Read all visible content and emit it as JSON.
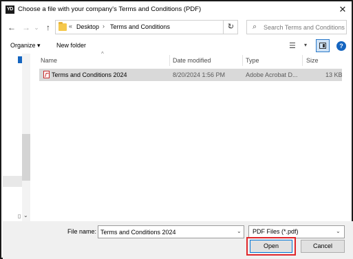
{
  "window": {
    "app_icon_text": "YD",
    "title": "Choose a file with your company's Terms and Conditions (PDF)",
    "close_glyph": "✕"
  },
  "nav": {
    "back_glyph": "←",
    "forward_glyph": "→",
    "recent_glyph": "⌄",
    "up_glyph": "↑",
    "breadcrumb_overflow": "«",
    "breadcrumbs": [
      {
        "label": "Desktop"
      },
      {
        "label": "Terms and Conditions"
      }
    ],
    "breadcrumb_sep": "›",
    "dropdown_glyph": "⌄",
    "refresh_glyph": "↻",
    "search_icon": "search-icon",
    "search_placeholder": "Search Terms and Conditions"
  },
  "toolbar": {
    "organize_label": "Organize ▾",
    "new_folder_label": "New folder",
    "view_glyph": "☰",
    "view_drop_glyph": "▾",
    "help_glyph": "?"
  },
  "filelist": {
    "columns": [
      "Name",
      "Date modified",
      "Type",
      "Size"
    ],
    "sort_glyph": "^",
    "rows": [
      {
        "name": "Terms and Conditions 2024",
        "date_modified": "8/20/2024 1:56 PM",
        "type": "Adobe Acrobat D...",
        "size": "13 KB",
        "selected": true
      }
    ]
  },
  "navpane": {
    "down_glyph": "⌄",
    "doc_glyph": "▯"
  },
  "footer": {
    "filename_label": "File name:",
    "filename_value": "Terms and Conditions 2024",
    "filename_drop_glyph": "⌄",
    "filetype_value": "PDF Files (*.pdf)",
    "filetype_drop_glyph": "⌄",
    "open_label": "Open",
    "cancel_label": "Cancel"
  },
  "colors": {
    "accent": "#0078d7",
    "highlight_box": "#e0262a",
    "selected_row": "#d9d9d9",
    "pdf_red": "#c62828"
  }
}
